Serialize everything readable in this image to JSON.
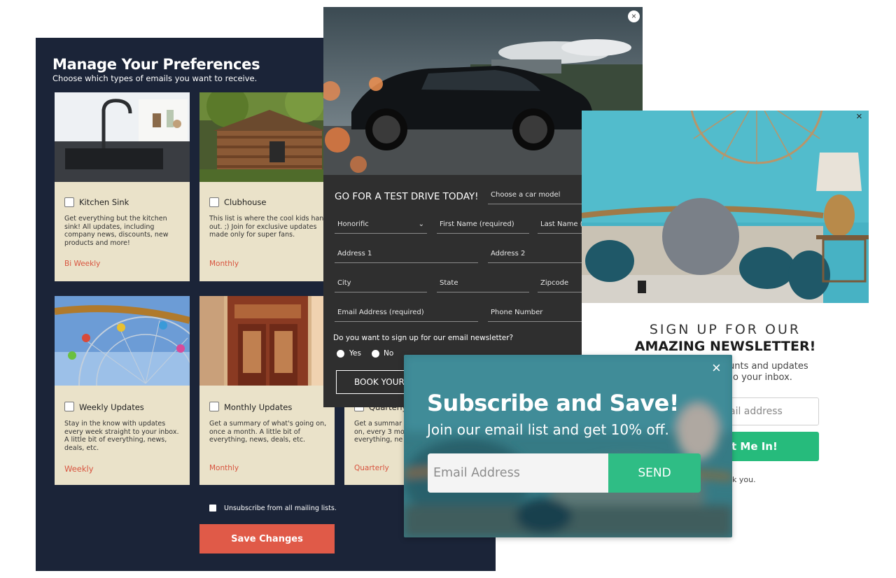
{
  "preferences": {
    "title": "Manage Your Preferences",
    "subtitle": "Choose which types of emails you want to receive.",
    "cards": [
      {
        "name": "Kitchen Sink",
        "description": "Get everything but the kitchen sink! All updates, including company news, discounts, new products and more!",
        "frequency": "Bi Weekly"
      },
      {
        "name": "Clubhouse",
        "description": "This list is where the cool kids hang out. ;) Join for exclusive updates made only for super fans.",
        "frequency": "Monthly"
      },
      {
        "name": "Weekly Updates",
        "description": "Stay in the know with updates every week straight to your inbox. A little bit of everything, news, deals, etc.",
        "frequency": "Weekly"
      },
      {
        "name": "Monthly Updates",
        "description": "Get a summary of what's going on, once a month. A little bit of everything, news, deals, etc.",
        "frequency": "Monthly"
      },
      {
        "name": "Quarterly",
        "description": "Get a summar on, every 3 mo everything, ne",
        "frequency": "Quarterly"
      }
    ],
    "unsubscribe_label": "Unsubscribe from all mailing lists.",
    "save_label": "Save Changes",
    "accent_color": "#e05a48"
  },
  "test_drive": {
    "close_icon": "×",
    "title": "GO FOR A TEST DRIVE TODAY!",
    "car_model_placeholder": "Choose a car model",
    "honorific_label": "Honorific",
    "first_name_placeholder": "First Name (required)",
    "last_name_placeholder": "Last Name (r",
    "address1_placeholder": "Address 1",
    "address2_placeholder": "Address 2",
    "city_placeholder": "City",
    "state_placeholder": "State",
    "zipcode_placeholder": "Zipcode",
    "email_placeholder": "Email Address (required)",
    "phone_placeholder": "Phone Number",
    "newsletter_question": "Do you want to sign up for our email newsletter?",
    "yes_label": "Yes",
    "no_label": "No",
    "book_label": "BOOK YOUR"
  },
  "newsletter": {
    "close_icon": "×",
    "line1": "SIGN UP FOR OUR",
    "line2": "AMAZING NEWSLETTER!",
    "text_line1": "unts and updates",
    "text_line2": "o your inbox.",
    "email_placeholder": "ail address",
    "button_label": "t Me In!",
    "thanks_text": "k you.",
    "button_color": "#26bb7c"
  },
  "subscribe": {
    "close_icon": "×",
    "title": "Subscribe and Save!",
    "subtitle": "Join our email list and get 10% off.",
    "email_placeholder": "Email Address",
    "button_label": "SEND",
    "button_color": "#2fbd85"
  }
}
